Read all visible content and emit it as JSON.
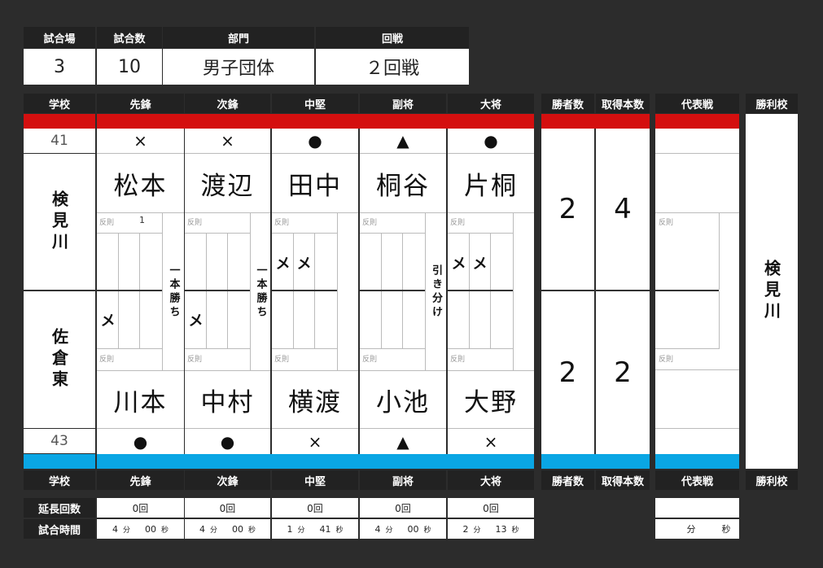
{
  "info": {
    "headers": [
      "試合場",
      "試合数",
      "部門",
      "回戦"
    ],
    "venue": "3",
    "match_no": "10",
    "division": "男子団体",
    "round": "２回戦"
  },
  "header_row": {
    "school": "学校",
    "positions": [
      "先鋒",
      "次鋒",
      "中堅",
      "副将",
      "大将"
    ],
    "wins": "勝者数",
    "points": "取得本数",
    "playoff": "代表戦",
    "winner": "勝利校"
  },
  "team_a": {
    "score": "41",
    "name": "検見川",
    "marks": [
      "×",
      "×",
      "●",
      "▲",
      "●"
    ],
    "players": [
      "松本",
      "渡辺",
      "田中",
      "桐谷",
      "片桐"
    ],
    "wins": "2",
    "points": "4"
  },
  "team_b": {
    "score": "43",
    "name": "佐倉東",
    "marks": [
      "●",
      "●",
      "×",
      "▲",
      "×"
    ],
    "players": [
      "川本",
      "中村",
      "横渡",
      "小池",
      "大野"
    ],
    "wins": "2",
    "points": "2"
  },
  "bouts": [
    {
      "a_foul": "反則",
      "a_foul_count": "1",
      "a_waza": [
        "",
        "",
        ""
      ],
      "b_foul": "反則",
      "b_waza": [
        "メ",
        "",
        ""
      ],
      "result": "一本勝ち"
    },
    {
      "a_foul": "反則",
      "a_foul_count": "",
      "a_waza": [
        "",
        "",
        ""
      ],
      "b_foul": "反則",
      "b_waza": [
        "メ",
        "",
        ""
      ],
      "result": "一本勝ち"
    },
    {
      "a_foul": "反則",
      "a_foul_count": "",
      "a_waza": [
        "メ",
        "メ",
        ""
      ],
      "b_foul": "反則",
      "b_waza": [
        "",
        "",
        ""
      ],
      "result": ""
    },
    {
      "a_foul": "反則",
      "a_foul_count": "",
      "a_waza": [
        "",
        "",
        ""
      ],
      "b_foul": "反則",
      "b_waza": [
        "",
        "",
        ""
      ],
      "result": "引き分け"
    },
    {
      "a_foul": "反則",
      "a_foul_count": "",
      "a_waza": [
        "メ",
        "メ",
        ""
      ],
      "b_foul": "反則",
      "b_waza": [
        "",
        "",
        ""
      ],
      "result": ""
    }
  ],
  "playoff": {
    "a_foul": "反則",
    "b_foul": "反則"
  },
  "winner_school": "検見川",
  "footer": {
    "extension_label": "延長回数",
    "time_label": "試合時間",
    "extensions": [
      "0回",
      "0回",
      "0回",
      "0回",
      "0回"
    ],
    "times": [
      {
        "min": "4",
        "sec": "00"
      },
      {
        "min": "4",
        "sec": "00"
      },
      {
        "min": "1",
        "sec": "41"
      },
      {
        "min": "4",
        "sec": "00"
      },
      {
        "min": "2",
        "sec": "13"
      }
    ],
    "min_unit": "分",
    "sec_unit": "秒",
    "playoff_extension": "",
    "playoff_time": {
      "min": "",
      "sec": ""
    }
  },
  "colors": {
    "team_a": "#d40f0f",
    "team_b": "#0aa6e4",
    "dark": "#222222",
    "frame": "#2c2c2c"
  }
}
